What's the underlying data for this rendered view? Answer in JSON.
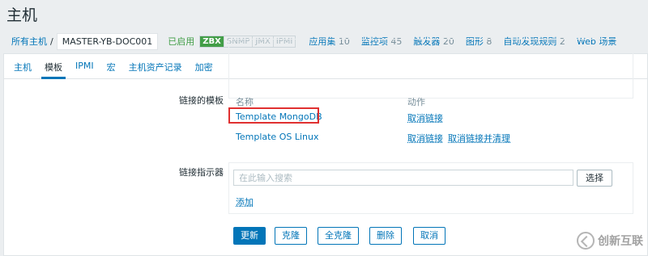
{
  "page": {
    "title": "主机"
  },
  "breadcrumb": {
    "all_hosts": "所有主机",
    "separator": "/",
    "current_host": "MASTER-YB-DOC001",
    "status": "已启用",
    "availability": [
      "ZBX",
      "SNMP",
      "JMX",
      "IPMI"
    ]
  },
  "host_nav": [
    {
      "label": "应用集",
      "count": "10"
    },
    {
      "label": "监控项",
      "count": "45"
    },
    {
      "label": "触发器",
      "count": "20"
    },
    {
      "label": "图形",
      "count": "8"
    },
    {
      "label": "自动发现规则",
      "count": "2"
    },
    {
      "label": "Web 场景",
      "count": ""
    }
  ],
  "tabs": [
    "主机",
    "模板",
    "IPMI",
    "宏",
    "主机资产记录",
    "加密"
  ],
  "linked_templates": {
    "label": "链接的模板",
    "columns": {
      "name": "名称",
      "action": "动作"
    },
    "rows": [
      {
        "name": "Template MongoDB",
        "actions": [
          "取消链接"
        ]
      },
      {
        "name": "Template OS Linux",
        "actions": [
          "取消链接",
          "取消链接并清理"
        ]
      }
    ]
  },
  "link_indicator": {
    "label": "链接指示器",
    "search_placeholder": "在此输入搜索",
    "select_label": "选择",
    "add_label": "添加"
  },
  "actions": {
    "update": "更新",
    "clone": "克隆",
    "full_clone": "全克隆",
    "delete": "删除",
    "cancel": "取消"
  },
  "watermark": "创新互联",
  "colors": {
    "accent": "#0275b8",
    "enabled": "#429e47",
    "highlight": "#e03030"
  }
}
